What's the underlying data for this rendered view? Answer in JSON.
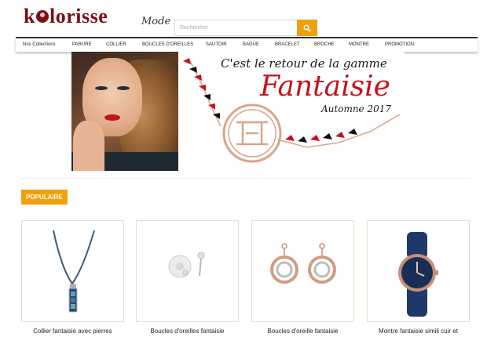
{
  "header": {
    "logo_main_prefix": "k",
    "logo_main_suffix": "lorisse",
    "logo_sub": "Mode",
    "search_placeholder": "Rechercher",
    "search_icon": "search-icon"
  },
  "colors": {
    "accent": "#f0a00c",
    "brand": "#7a0f16",
    "banner_red": "#c8101e"
  },
  "nav": {
    "items": [
      {
        "label": "Nos Collections"
      },
      {
        "label": "PARURE"
      },
      {
        "label": "COLLIER"
      },
      {
        "label": "BOUCLES D'OREILLES"
      },
      {
        "label": "SAUTOIR"
      },
      {
        "label": "BAGUE"
      },
      {
        "label": "BRACELET"
      },
      {
        "label": "BROCHE"
      },
      {
        "label": "MONTRE"
      },
      {
        "label": "PROMOTION"
      }
    ]
  },
  "banner": {
    "line1": "C'est le retour de la gamme",
    "line2": "Fantaisie",
    "line3": "Automne 2017"
  },
  "popular": {
    "title": "POPULAIRE",
    "products": [
      {
        "name": "Collier fantaisie avec pierres",
        "image_icon": "necklace-icon"
      },
      {
        "name": "Boucles d'oreilles fantaisie",
        "image_icon": "stud-earrings-icon"
      },
      {
        "name": "Boucles d'oreille fantaisie",
        "image_icon": "hoop-earrings-icon"
      },
      {
        "name": "Montre fantaisie simili cuir et",
        "image_icon": "watch-icon"
      }
    ]
  }
}
